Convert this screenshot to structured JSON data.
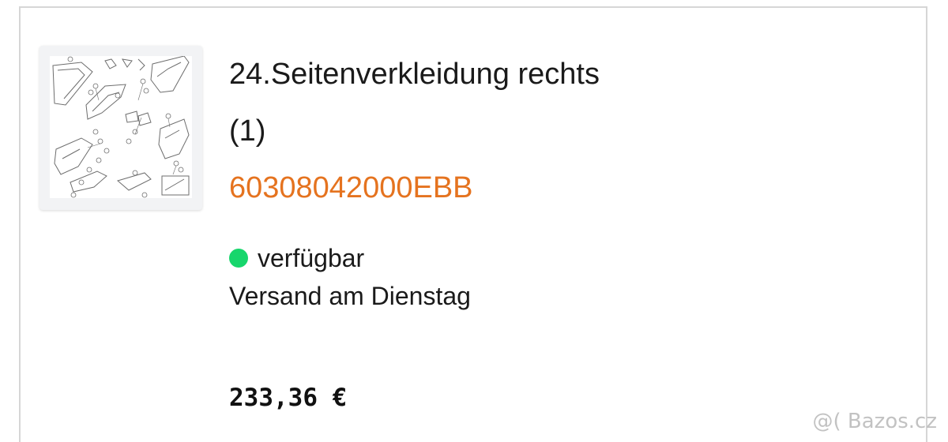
{
  "product": {
    "title": "24.Seitenverkleidung rechts",
    "quantity": "(1)",
    "part_number": "60308042000EBB",
    "availability": "verfügbar",
    "shipping": "Versand am Dienstag",
    "price": "233,36 €",
    "thumbnail_icon": "exploded-parts-diagram"
  },
  "watermark": "@( Bazos.cz",
  "colors": {
    "part_number": "#e5731f",
    "availability_dot": "#17d66c",
    "text": "#1a1a1a",
    "border": "#d6d6d6"
  }
}
